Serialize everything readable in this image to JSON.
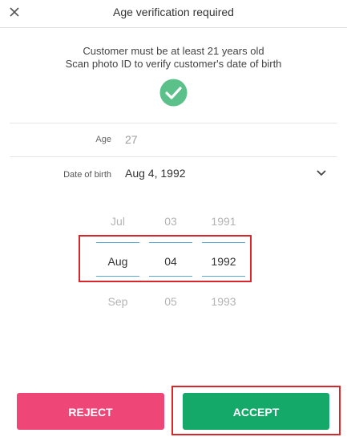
{
  "header": {
    "title": "Age verification required",
    "close_icon": "close-icon"
  },
  "instructions": {
    "line1": "Customer must be at least 21 years old",
    "line2": "Scan photo ID to verify customer's date of birth"
  },
  "status_icon": "check-circle-icon",
  "age": {
    "label": "Age",
    "value": "27"
  },
  "dob": {
    "label": "Date of birth",
    "value": "Aug 4, 1992",
    "dropdown_icon": "chevron-down-icon"
  },
  "picker": {
    "month": {
      "prev": "Jul",
      "selected": "Aug",
      "next": "Sep"
    },
    "day": {
      "prev": "03",
      "selected": "04",
      "next": "05"
    },
    "year": {
      "prev": "1991",
      "selected": "1992",
      "next": "1993"
    }
  },
  "buttons": {
    "reject": "REJECT",
    "accept": "ACCEPT"
  },
  "colors": {
    "accept": "#14a869",
    "reject": "#ef4678",
    "check": "#5cc08a",
    "picker_line": "#5aaad8",
    "highlight_box": "#d9262a"
  }
}
